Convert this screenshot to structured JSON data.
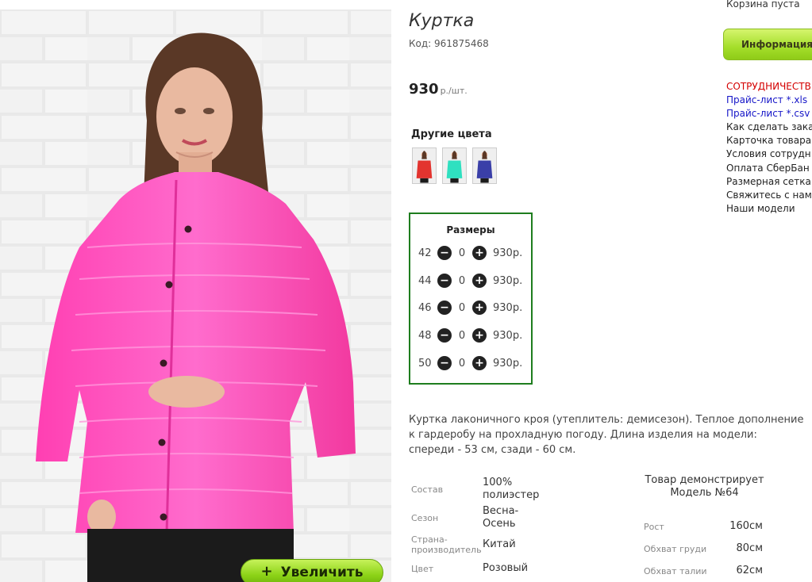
{
  "product": {
    "title": "Куртка",
    "code": "Код: 961875468",
    "price": "930",
    "price_unit": "р./шт.",
    "other_colors_label": "Другие цвета",
    "color_swatches": [
      {
        "name": "red",
        "color": "#e3342f"
      },
      {
        "name": "mint",
        "color": "#2fe0c0"
      },
      {
        "name": "navy",
        "color": "#3a3fa8"
      }
    ],
    "sizes_title": "Размеры",
    "sizes": [
      {
        "size": "42",
        "qty": "0",
        "price": "930р."
      },
      {
        "size": "44",
        "qty": "0",
        "price": "930р."
      },
      {
        "size": "46",
        "qty": "0",
        "price": "930р."
      },
      {
        "size": "48",
        "qty": "0",
        "price": "930р."
      },
      {
        "size": "50",
        "qty": "0",
        "price": "930р."
      }
    ],
    "description": "Куртка лаконичного кроя (утеплитель: демисезон). Теплое дополнение к гардеробу на прохладную погоду. Длина изделия на модели: спереди - 53 см, сзади - 60 см.",
    "attributes": [
      {
        "label": "Состав",
        "value": "100% полиэстер"
      },
      {
        "label": "Сезон",
        "value": "Весна-Осень"
      },
      {
        "label": "Страна-производитель",
        "value": "Китай"
      },
      {
        "label": "Цвет",
        "value": "Розовый"
      }
    ],
    "model_title": "Товар демонстрирует Модель №64",
    "model_params": [
      {
        "label": "Рост",
        "value": "160см"
      },
      {
        "label": "Обхват груди",
        "value": "80см"
      },
      {
        "label": "Обхват талии",
        "value": "62см"
      }
    ],
    "zoom_label": "Увеличить",
    "zoom_icon": "plus-icon",
    "jacket_color": "#ff4fbf"
  },
  "sidebar": {
    "cart_status": "Корзина пуста",
    "info_button": "Информация",
    "links": [
      {
        "label": "СОТРУДНИЧЕСТВ",
        "style": "red"
      },
      {
        "label": "Прайс-лист *.xls",
        "style": "blue"
      },
      {
        "label": "Прайс-лист *.csv",
        "style": "blue"
      },
      {
        "label": "Как сделать зака",
        "style": "normal"
      },
      {
        "label": "Карточка товара",
        "style": "normal"
      },
      {
        "label": "Условия сотрудн",
        "style": "normal"
      },
      {
        "label": "Оплата СберБан",
        "style": "normal"
      },
      {
        "label": "Размерная сетка",
        "style": "normal"
      },
      {
        "label": "Свяжитесь с нам",
        "style": "normal"
      },
      {
        "label": "Наши модели",
        "style": "normal"
      }
    ]
  },
  "colors": {
    "sizes_border": "#1e7d1e",
    "zoom_button": "#8dd318",
    "link_red": "#d40000",
    "link_blue": "#1616c8"
  }
}
